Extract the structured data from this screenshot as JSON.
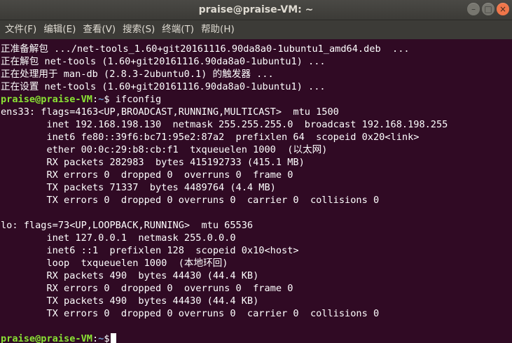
{
  "window": {
    "title": "praise@praise-VM: ~",
    "controls": {
      "minimize": "–",
      "maximize": "□",
      "close": "×"
    }
  },
  "menu": [
    "文件(F)",
    "编辑(E)",
    "查看(V)",
    "搜索(S)",
    "终端(T)",
    "帮助(H)"
  ],
  "prompt": {
    "user": "praise@praise-VM",
    "separator": ":",
    "path": "~",
    "symbol": "$"
  },
  "terminal": {
    "pre_lines": [
      "正准备解包 .../net-tools_1.60+git20161116.90da8a0-1ubuntu1_amd64.deb  ...",
      "正在解包 net-tools (1.60+git20161116.90da8a0-1ubuntu1) ...",
      "正在处理用于 man-db (2.8.3-2ubuntu0.1) 的触发器 ...",
      "正在设置 net-tools (1.60+git20161116.90da8a0-1ubuntu1) ..."
    ],
    "command": " ifconfig",
    "output_lines": [
      "ens33: flags=4163<UP,BROADCAST,RUNNING,MULTICAST>  mtu 1500",
      "        inet 192.168.198.130  netmask 255.255.255.0  broadcast 192.168.198.255",
      "        inet6 fe80::39f6:bc71:95e2:87a2  prefixlen 64  scopeid 0x20<link>",
      "        ether 00:0c:29:b8:cb:f1  txqueuelen 1000  (以太网)",
      "        RX packets 282983  bytes 415192733 (415.1 MB)",
      "        RX errors 0  dropped 0  overruns 0  frame 0",
      "        TX packets 71337  bytes 4489764 (4.4 MB)",
      "        TX errors 0  dropped 0 overruns 0  carrier 0  collisions 0",
      "",
      "lo: flags=73<UP,LOOPBACK,RUNNING>  mtu 65536",
      "        inet 127.0.0.1  netmask 255.0.0.0",
      "        inet6 ::1  prefixlen 128  scopeid 0x10<host>",
      "        loop  txqueuelen 1000  (本地环回)",
      "        RX packets 490  bytes 44430 (44.4 KB)",
      "        RX errors 0  dropped 0  overruns 0  frame 0",
      "        TX packets 490  bytes 44430 (44.4 KB)",
      "        TX errors 0  dropped 0 overruns 0  carrier 0  collisions 0",
      ""
    ]
  },
  "colors": {
    "background": "#300a24",
    "prompt_user": "#8ae234",
    "prompt_path": "#729fcf",
    "text": "#ffffff"
  }
}
